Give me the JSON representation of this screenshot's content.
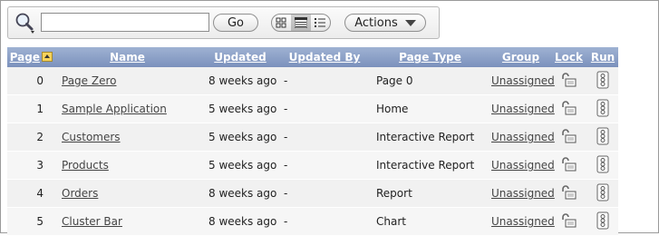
{
  "toolbar": {
    "search": {
      "value": "",
      "placeholder": ""
    },
    "go_label": "Go",
    "actions_label": "Actions",
    "view_modes": [
      "icons-view",
      "report-view",
      "details-view"
    ],
    "active_view": "report-view"
  },
  "table": {
    "columns": [
      "Page",
      "Name",
      "Updated",
      "Updated By",
      "Page Type",
      "Group",
      "Lock",
      "Run"
    ],
    "sorted_column": "Page",
    "rows": [
      {
        "page": "0",
        "name": "Page Zero",
        "updated": "8 weeks ago",
        "updated_by": "-",
        "page_type": "Page 0",
        "group": "Unassigned"
      },
      {
        "page": "1",
        "name": "Sample Application",
        "updated": "5 weeks ago",
        "updated_by": "-",
        "page_type": "Home",
        "group": "Unassigned"
      },
      {
        "page": "2",
        "name": "Customers",
        "updated": "5 weeks ago",
        "updated_by": "-",
        "page_type": "Interactive Report",
        "group": "Unassigned"
      },
      {
        "page": "3",
        "name": "Products",
        "updated": "5 weeks ago",
        "updated_by": "-",
        "page_type": "Interactive Report",
        "group": "Unassigned"
      },
      {
        "page": "4",
        "name": "Orders",
        "updated": "8 weeks ago",
        "updated_by": "-",
        "page_type": "Report",
        "group": "Unassigned"
      },
      {
        "page": "5",
        "name": "Cluster Bar",
        "updated": "8 weeks ago",
        "updated_by": "-",
        "page_type": "Chart",
        "group": "Unassigned"
      }
    ]
  },
  "colors": {
    "header_top": "#9fb2d3",
    "header_bottom": "#7b91bc",
    "row_bg": "#f1f1f1"
  }
}
